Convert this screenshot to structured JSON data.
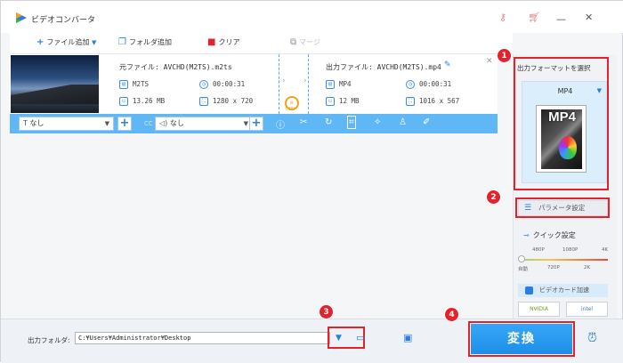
{
  "app": {
    "title": "ビデオコンバータ"
  },
  "toolbar": {
    "add_file": "ファイル追加",
    "add_folder": "フォルダ追加",
    "clear": "クリア",
    "merge": "マージ"
  },
  "item": {
    "source_title": "元ファイル: AVCHD(M2TS).m2ts",
    "output_title": "出力ファイル: AVCHD(M2TS).mp4",
    "source": {
      "format": "M2TS",
      "duration": "00:00:31",
      "size": "13.26 MB",
      "resolution": "1280 x 720"
    },
    "output": {
      "format": "MP4",
      "duration": "00:00:31",
      "size": "12 MB",
      "resolution": "1016 x 567"
    },
    "gpu_label": "GPU"
  },
  "editbar": {
    "subtitle_value": "なし",
    "audio_value": "なし",
    "cc_label": "CC"
  },
  "panel": {
    "format_title": "出力フォーマットを選択",
    "format_name": "MP4",
    "format_badge": "MP4",
    "param_button": "パラメータ設定",
    "quick_title": "クイック設定",
    "res_top": [
      "480P",
      "1080P",
      "4K"
    ],
    "res_bottom": [
      "自動",
      "720P",
      "2K"
    ],
    "gpu_accel": "ビデオカード加速",
    "vendors": [
      "NVIDIA",
      "intel"
    ]
  },
  "footer": {
    "output_label": "出力フォルダ:",
    "output_path": "C:¥Users¥Administrator¥Desktop",
    "convert_button": "変換"
  },
  "badges": [
    "1",
    "2",
    "3",
    "4"
  ],
  "colors": {
    "accent": "#2a7de1",
    "edit_bar": "#5fb7f5",
    "highlight": "#e5222b",
    "gpu": "#f0a21b"
  }
}
